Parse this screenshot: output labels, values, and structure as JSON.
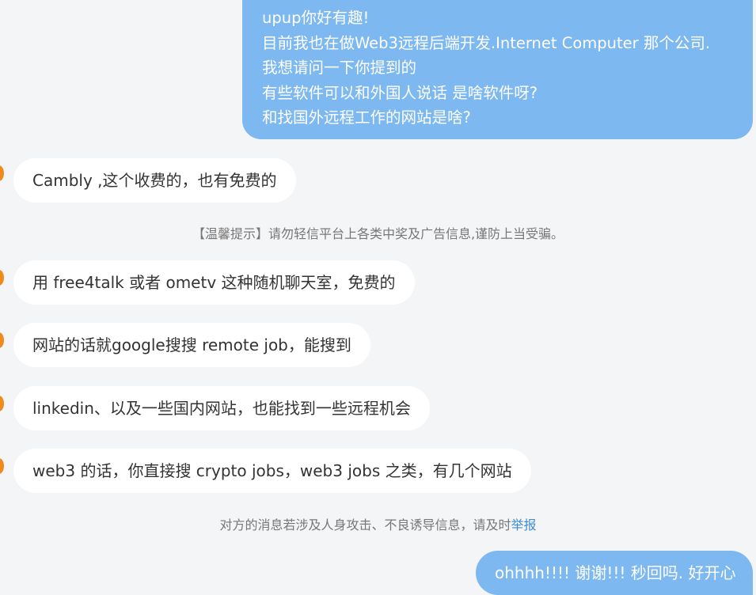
{
  "messages": {
    "out_1": {
      "lines": [
        "upup你好有趣!",
        "目前我也在做Web3远程后端开发.Internet Computer 那个公司.",
        "我想请问一下你提到的",
        "有些软件可以和外国人说话 是啥软件呀?",
        "和找国外远程工作的网站是啥?"
      ]
    },
    "in_1": "Cambly ,这个收费的，也有免费的",
    "in_2": "用 free4talk 或者 ometv 这种随机聊天室，免费的",
    "in_3": "网站的话就google搜搜 remote job，能搜到",
    "in_4": "linkedin、以及一些国内网站，也能找到一些远程机会",
    "in_5": "web3 的话，你直接搜 crypto jobs，web3 jobs 之类，有几个网站",
    "out_2": "ohhhh!!!! 谢谢!!! 秒回吗. 好开心"
  },
  "notices": {
    "warm_tip": "【温馨提示】请勿轻信平台上各类中奖及广告信息,谨防上当受骗。",
    "report_prefix": "对方的消息若涉及人身攻击、不良诱导信息，请及时",
    "report_link": "举报"
  },
  "colors": {
    "outgoing_bubble": "#7db8f0",
    "incoming_bubble": "#ffffff",
    "background": "#f4f5f7",
    "avatar": "#f08a1c",
    "link": "#3f8bd0"
  }
}
